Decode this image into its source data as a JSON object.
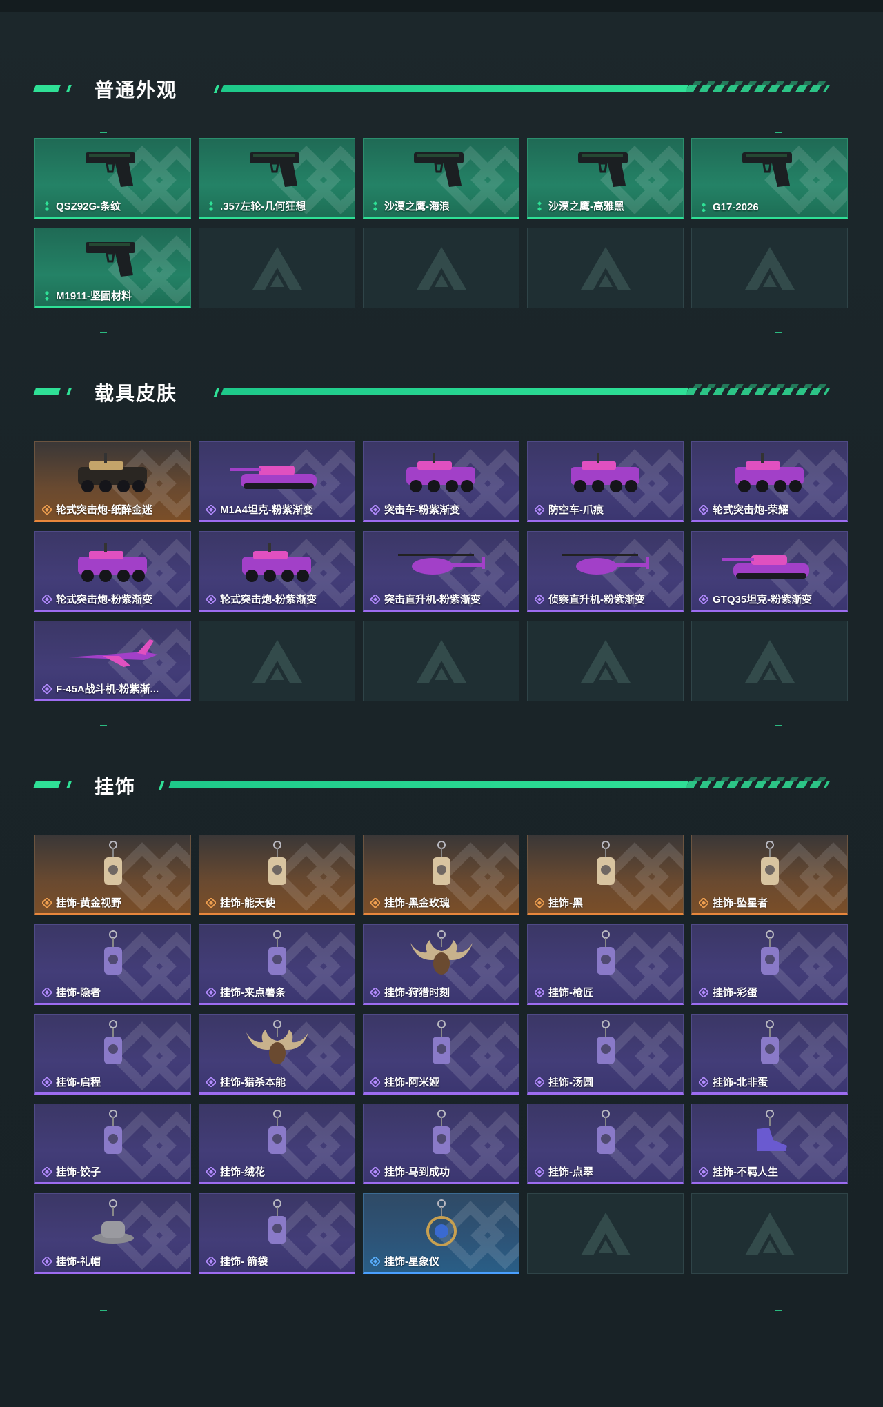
{
  "sections": [
    {
      "title": "普通外观",
      "items": [
        {
          "label": "QSZ92G-条纹",
          "rarity": "green",
          "icon": "pistol-icon"
        },
        {
          "label": ".357左轮-几何狂想",
          "rarity": "green",
          "icon": "revolver-icon"
        },
        {
          "label": "沙漠之鹰-海浪",
          "rarity": "green",
          "icon": "pistol-icon"
        },
        {
          "label": "沙漠之鹰-高雅黑",
          "rarity": "green",
          "icon": "pistol-icon"
        },
        {
          "label": "G17-2026",
          "rarity": "green",
          "icon": "pistol-icon"
        },
        {
          "label": "M1911-坚固材料",
          "rarity": "green",
          "icon": "pistol-icon"
        }
      ],
      "empty_slots": 4
    },
    {
      "title": "载具皮肤",
      "items": [
        {
          "label": "轮式突击炮-纸醉金迷",
          "rarity": "orange",
          "icon": "armored-car-icon"
        },
        {
          "label": "M1A4坦克-粉紫渐变",
          "rarity": "purple",
          "icon": "tank-icon"
        },
        {
          "label": "突击车-粉紫渐变",
          "rarity": "purple",
          "icon": "buggy-icon"
        },
        {
          "label": "防空车-爪痕",
          "rarity": "purple",
          "icon": "armored-car-icon"
        },
        {
          "label": "轮式突击炮-荣耀",
          "rarity": "purple",
          "icon": "armored-car-icon"
        },
        {
          "label": "轮式突击炮-粉紫渐变",
          "rarity": "purple",
          "icon": "armored-car-icon"
        },
        {
          "label": "轮式突击炮-粉紫渐变",
          "rarity": "purple",
          "icon": "armored-car-icon"
        },
        {
          "label": "突击直升机-粉紫渐变",
          "rarity": "purple",
          "icon": "helicopter-icon"
        },
        {
          "label": "侦察直升机-粉紫渐变",
          "rarity": "purple",
          "icon": "helicopter-icon"
        },
        {
          "label": "GTQ35坦克-粉紫渐变",
          "rarity": "purple",
          "icon": "tank-icon"
        },
        {
          "label": "F-45A战斗机-粉紫渐...",
          "rarity": "purple",
          "icon": "jet-icon"
        }
      ],
      "empty_slots": 4
    },
    {
      "title": "挂饰",
      "items": [
        {
          "label": "挂饰-黄金视野",
          "rarity": "orange",
          "icon": "charm-icon"
        },
        {
          "label": "挂饰-能天使",
          "rarity": "orange",
          "icon": "charm-icon"
        },
        {
          "label": "挂饰-黑金玫瑰",
          "rarity": "orange",
          "icon": "charm-icon"
        },
        {
          "label": "挂饰-黑",
          "rarity": "orange",
          "icon": "charm-icon"
        },
        {
          "label": "挂饰-坠星者",
          "rarity": "orange",
          "icon": "charm-icon"
        },
        {
          "label": "挂饰-隐者",
          "rarity": "purple",
          "icon": "charm-icon"
        },
        {
          "label": "挂饰-来点薯条",
          "rarity": "purple",
          "icon": "charm-icon"
        },
        {
          "label": "挂饰-狩猎时刻",
          "rarity": "purple",
          "icon": "antler-charm-icon"
        },
        {
          "label": "挂饰-枪匠",
          "rarity": "purple",
          "icon": "charm-icon"
        },
        {
          "label": "挂饰-彩蛋",
          "rarity": "purple",
          "icon": "charm-icon"
        },
        {
          "label": "挂饰-启程",
          "rarity": "purple",
          "icon": "charm-icon"
        },
        {
          "label": "挂饰-猎杀本能",
          "rarity": "purple",
          "icon": "antler-charm-icon"
        },
        {
          "label": "挂饰-阿米娅",
          "rarity": "purple",
          "icon": "charm-icon"
        },
        {
          "label": "挂饰-汤圆",
          "rarity": "purple",
          "icon": "charm-icon"
        },
        {
          "label": "挂饰-北非蛋",
          "rarity": "purple",
          "icon": "charm-icon"
        },
        {
          "label": "挂饰-饺子",
          "rarity": "purple",
          "icon": "charm-icon"
        },
        {
          "label": "挂饰-绒花",
          "rarity": "purple",
          "icon": "charm-icon"
        },
        {
          "label": "挂饰-马到成功",
          "rarity": "purple",
          "icon": "charm-icon"
        },
        {
          "label": "挂饰-点翠",
          "rarity": "purple",
          "icon": "charm-icon"
        },
        {
          "label": "挂饰-不羁人生",
          "rarity": "purple",
          "icon": "sneaker-charm-icon"
        },
        {
          "label": "挂饰-礼帽",
          "rarity": "purple",
          "icon": "hat-charm-icon"
        },
        {
          "label": "挂饰- 箭袋",
          "rarity": "purple",
          "icon": "charm-icon"
        },
        {
          "label": "挂饰-星象仪",
          "rarity": "blue",
          "icon": "orb-charm-icon"
        }
      ],
      "empty_slots": 2
    }
  ],
  "colors": {
    "accent": "#2fe096",
    "green_card": "#248266",
    "purple_card": "#433d78",
    "orange_card": "#6a4a30",
    "blue_card": "#2d5478",
    "background": "#1b2529"
  }
}
